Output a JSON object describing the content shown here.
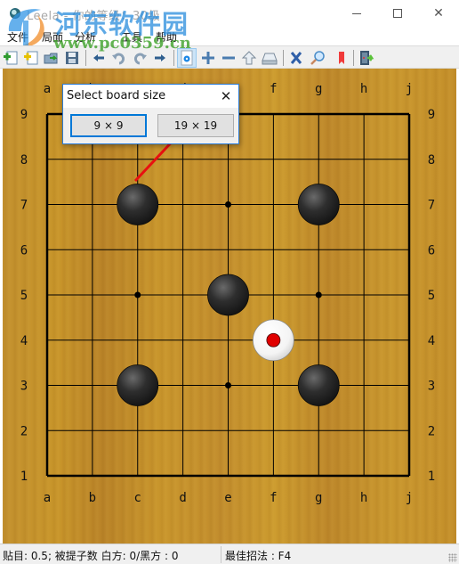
{
  "window": {
    "title": "Leela - 你的等级：30级",
    "minimize_glyph": "—",
    "maximize_glyph": "□",
    "close_glyph": "✕"
  },
  "watermark": {
    "title": "河东软件园",
    "url": "www.pc0359.cn"
  },
  "menu": {
    "items": [
      {
        "label": "文件"
      },
      {
        "label": "局面"
      },
      {
        "label": "分析"
      },
      {
        "label": "工具"
      },
      {
        "label": "帮助"
      }
    ]
  },
  "toolbar": {
    "buttons": [
      {
        "name": "new-game",
        "icon": "new-doc-green-plus-icon"
      },
      {
        "name": "new-setup",
        "icon": "new-doc-yellow-plus-icon"
      },
      {
        "name": "open",
        "icon": "open-folder-icon"
      },
      {
        "name": "save",
        "icon": "floppy-disk-icon"
      },
      {
        "name": "back",
        "icon": "arrow-left-icon"
      },
      {
        "name": "undo",
        "icon": "undo-icon"
      },
      {
        "name": "redo",
        "icon": "redo-icon"
      },
      {
        "name": "forward",
        "icon": "arrow-right-icon"
      },
      {
        "name": "settings",
        "icon": "gear-doc-icon",
        "active": true
      },
      {
        "name": "zoom-in",
        "icon": "plus-icon"
      },
      {
        "name": "zoom-out",
        "icon": "minus-icon"
      },
      {
        "name": "pass",
        "icon": "arrow-up-icon"
      },
      {
        "name": "drive",
        "icon": "disk-drive-icon"
      },
      {
        "name": "resign",
        "icon": "x-cross-icon"
      },
      {
        "name": "analyze",
        "icon": "magnifier-icon"
      },
      {
        "name": "bookmark",
        "icon": "bookmark-icon"
      },
      {
        "name": "exit",
        "icon": "exit-door-icon"
      }
    ]
  },
  "board": {
    "size": 9,
    "columns": [
      "a",
      "b",
      "c",
      "d",
      "e",
      "f",
      "g",
      "h",
      "j"
    ],
    "rows": [
      "9",
      "8",
      "7",
      "6",
      "5",
      "4",
      "3",
      "2",
      "1"
    ],
    "star_points": [
      "e7",
      "c5",
      "g5",
      "e3"
    ],
    "stones": [
      {
        "point": "c7",
        "color": "black"
      },
      {
        "point": "g7",
        "color": "black"
      },
      {
        "point": "e5",
        "color": "black"
      },
      {
        "point": "f4",
        "color": "white",
        "last_move": true
      },
      {
        "point": "c3",
        "color": "black"
      },
      {
        "point": "g3",
        "color": "black"
      }
    ],
    "last_move_marker_color": "#e00000",
    "annotation_arrow_color": "#e81010"
  },
  "dialog": {
    "title": "Select board size",
    "close_glyph": "✕",
    "buttons": [
      {
        "label": "9 × 9",
        "default": true
      },
      {
        "label": "19 × 19",
        "default": false
      }
    ]
  },
  "status": {
    "left": "贴目: 0.5; 被提子数 白方: 0/黑方   : 0",
    "right": "最佳招法 : F4"
  }
}
